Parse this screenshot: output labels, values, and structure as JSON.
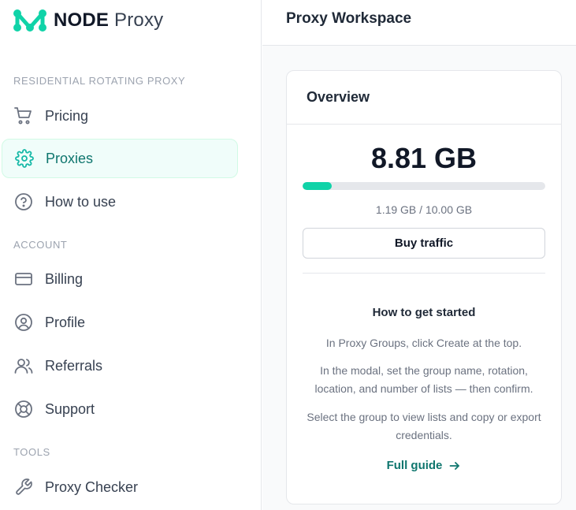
{
  "brand": {
    "name_bold": "NODE",
    "name_light": "Proxy",
    "accent": "#10d3a8",
    "accent_dark": "#0f766e"
  },
  "sidebar": {
    "sections": [
      {
        "label": "RESIDENTIAL ROTATING PROXY",
        "items": [
          {
            "label": "Pricing",
            "icon": "cart-icon"
          },
          {
            "label": "Proxies",
            "icon": "gear-icon",
            "active": true
          },
          {
            "label": "How to use",
            "icon": "help-circle-icon"
          }
        ]
      },
      {
        "label": "ACCOUNT",
        "items": [
          {
            "label": "Billing",
            "icon": "credit-card-icon"
          },
          {
            "label": "Profile",
            "icon": "user-circle-icon"
          },
          {
            "label": "Referrals",
            "icon": "users-icon"
          },
          {
            "label": "Support",
            "icon": "lifebuoy-icon"
          }
        ]
      },
      {
        "label": "TOOLS",
        "items": [
          {
            "label": "Proxy Checker",
            "icon": "wrench-icon"
          }
        ]
      }
    ]
  },
  "header": {
    "title": "Proxy Workspace"
  },
  "overview": {
    "title": "Overview",
    "remaining": "8.81 GB",
    "used_of_total": "1.19 GB / 10.00 GB",
    "progress_fraction": 0.119,
    "buy_button": "Buy traffic",
    "getting_started": {
      "title": "How to get started",
      "steps": [
        "In Proxy Groups, click Create at the top.",
        "In the modal, set the group name, rotation, location, and number of lists — then confirm.",
        "Select the group to view lists and copy or export credentials."
      ],
      "link": "Full guide"
    }
  }
}
